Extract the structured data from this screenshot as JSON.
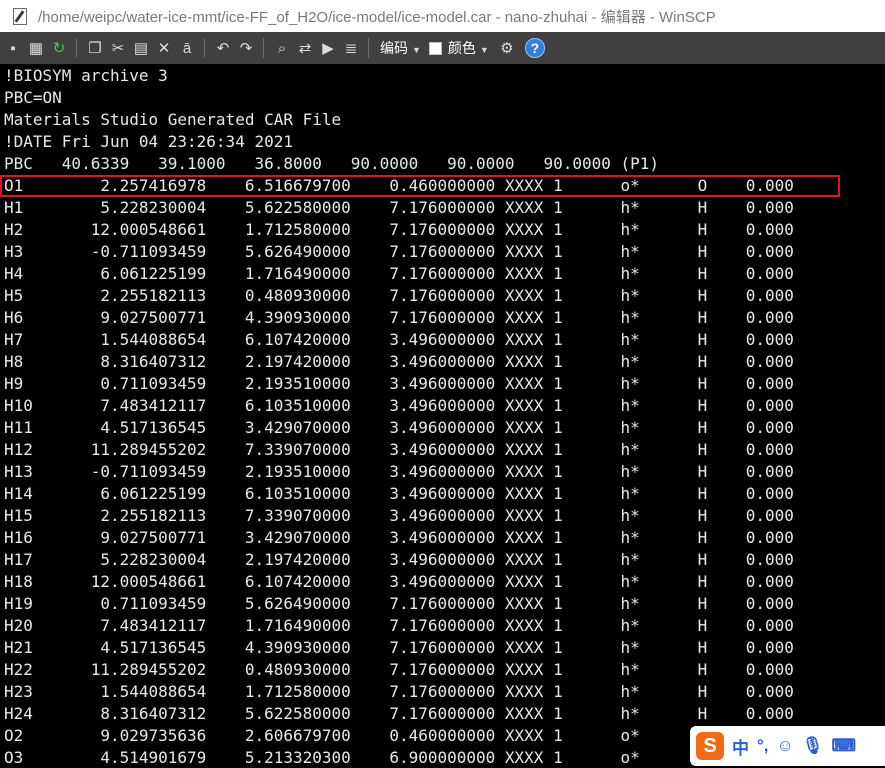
{
  "window": {
    "title": "/home/weipc/water-ice-mmt/ice-FF_of_H2O/ice-model/ice-model.car - nano-zhuhai - 编辑器 - WinSCP"
  },
  "toolbar": {
    "encoding_label": "编码",
    "color_label": "颜色",
    "help_label": "?"
  },
  "editor": {
    "lines": [
      "!BIOSYM archive 3",
      "PBC=ON",
      "Materials Studio Generated CAR File",
      "!DATE Fri Jun 04 23:26:34 2021",
      "PBC   40.6339   39.1000   36.8000   90.0000   90.0000   90.0000 (P1)",
      "O1        2.257416978    6.516679700    0.460000000 XXXX 1      o*      O    0.000",
      "H1        5.228230004    5.622580000    7.176000000 XXXX 1      h*      H    0.000",
      "H2       12.000548661    1.712580000    7.176000000 XXXX 1      h*      H    0.000",
      "H3       -0.711093459    5.626490000    7.176000000 XXXX 1      h*      H    0.000",
      "H4        6.061225199    1.716490000    7.176000000 XXXX 1      h*      H    0.000",
      "H5        2.255182113    0.480930000    7.176000000 XXXX 1      h*      H    0.000",
      "H6        9.027500771    4.390930000    7.176000000 XXXX 1      h*      H    0.000",
      "H7        1.544088654    6.107420000    3.496000000 XXXX 1      h*      H    0.000",
      "H8        8.316407312    2.197420000    3.496000000 XXXX 1      h*      H    0.000",
      "H9        0.711093459    2.193510000    3.496000000 XXXX 1      h*      H    0.000",
      "H10       7.483412117    6.103510000    3.496000000 XXXX 1      h*      H    0.000",
      "H11       4.517136545    3.429070000    3.496000000 XXXX 1      h*      H    0.000",
      "H12      11.289455202    7.339070000    3.496000000 XXXX 1      h*      H    0.000",
      "H13      -0.711093459    2.193510000    3.496000000 XXXX 1      h*      H    0.000",
      "H14       6.061225199    6.103510000    3.496000000 XXXX 1      h*      H    0.000",
      "H15       2.255182113    7.339070000    3.496000000 XXXX 1      h*      H    0.000",
      "H16       9.027500771    3.429070000    3.496000000 XXXX 1      h*      H    0.000",
      "H17       5.228230004    2.197420000    3.496000000 XXXX 1      h*      H    0.000",
      "H18      12.000548661    6.107420000    3.496000000 XXXX 1      h*      H    0.000",
      "H19       0.711093459    5.626490000    7.176000000 XXXX 1      h*      H    0.000",
      "H20       7.483412117    1.716490000    7.176000000 XXXX 1      h*      H    0.000",
      "H21       4.517136545    4.390930000    7.176000000 XXXX 1      h*      H    0.000",
      "H22      11.289455202    0.480930000    7.176000000 XXXX 1      h*      H    0.000",
      "H23       1.544088654    1.712580000    7.176000000 XXXX 1      h*      H    0.000",
      "H24       8.316407312    5.622580000    7.176000000 XXXX 1      h*      H    0.000",
      "O2        9.029735636    2.606679700    0.460000000 XXXX 1      o*      O    0.000",
      "O3        4.514901679    5.213320300    6.900000000 XXXX 1      o*      O    0.000"
    ],
    "highlighted_line": 6
  },
  "ime": {
    "logo": "S",
    "lang": "中",
    "punct": "°,"
  },
  "colors": {
    "toolbar_bg": "#404040",
    "editor_bg": "#000000",
    "text": "#e8e8e8",
    "highlight": "#e0141e"
  }
}
